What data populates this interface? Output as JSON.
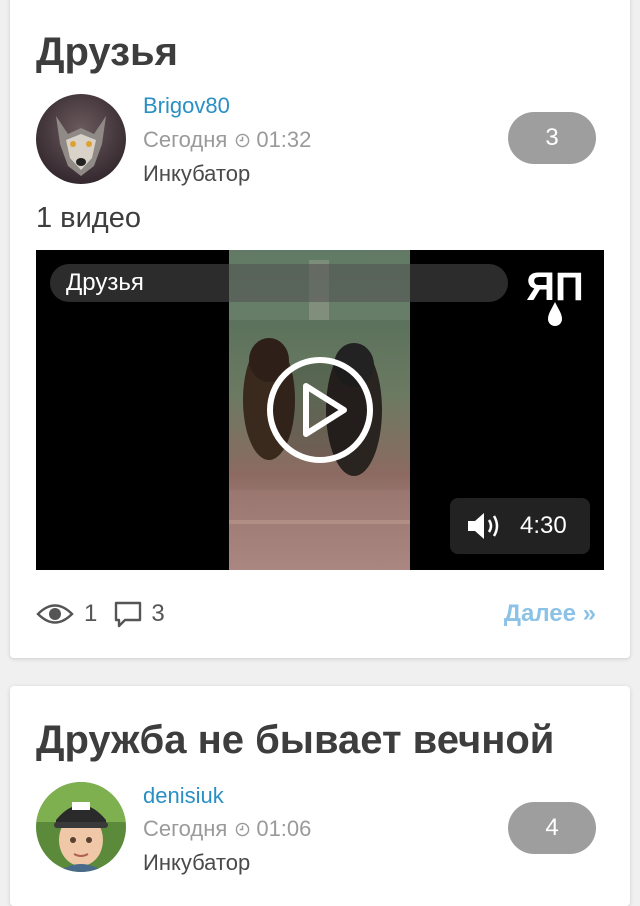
{
  "posts": [
    {
      "title": "Друзья",
      "author": "Brigov80",
      "date": "Сегодня",
      "time": "01:32",
      "category": "Инкубатор",
      "count": "3",
      "video_count": "1 видео",
      "video": {
        "title": "Друзья",
        "logo": "ЯП",
        "duration": "4:30"
      },
      "views": "1",
      "comments": "3",
      "more": "Далее »"
    },
    {
      "title": "Дружба не бывает вечной",
      "author": "denisiuk",
      "date": "Сегодня",
      "time": "01:06",
      "category": "Инкубатор",
      "count": "4"
    }
  ],
  "icons": {
    "clock": "clock-icon",
    "eye": "eye-icon",
    "comment": "comment-icon",
    "speaker": "speaker-icon",
    "play": "play-icon"
  },
  "colors": {
    "author_link": "#2a8fc4",
    "more_link": "#8cc2e6",
    "badge": "#9e9e9e",
    "title": "#3d3d3d"
  }
}
